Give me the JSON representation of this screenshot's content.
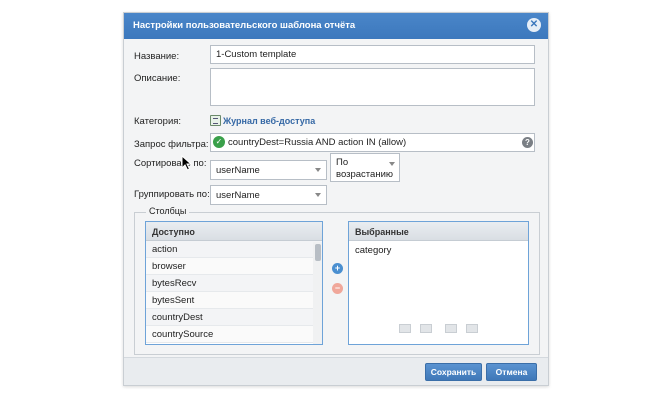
{
  "dialog": {
    "title": "Настройки пользовательского шаблона отчёта",
    "close_icon": "close-icon"
  },
  "form": {
    "name_label": "Название:",
    "name_value": "1-Custom template",
    "description_label": "Описание:",
    "description_value": "",
    "category_label": "Категория:",
    "category_value": "Журнал веб-доступа",
    "filter_label": "Запрос фильтра:",
    "filter_value": "countryDest=Russia AND action IN (allow)",
    "sort_label": "Сортировать по:",
    "sort_field": "userName",
    "sort_order": "По возрастанию",
    "group_label": "Группировать по:",
    "group_field": "userName"
  },
  "columns": {
    "legend": "Столбцы",
    "available_title": "Доступно",
    "available_items": [
      "action",
      "browser",
      "bytesRecv",
      "bytesSent",
      "countryDest",
      "countrySource"
    ],
    "selected_title": "Выбранные",
    "selected_items": [
      "category"
    ],
    "add_icon": "plus-icon",
    "remove_icon": "minus-icon"
  },
  "footer": {
    "save_label": "Сохранить",
    "cancel_label": "Отмена"
  },
  "colors": {
    "titlebar": "#3c78bd",
    "panel_border": "#6ea3d8",
    "add_button": "#4a8fd0",
    "remove_button": "#f0a79a",
    "filter_ok": "#3aa04a"
  }
}
